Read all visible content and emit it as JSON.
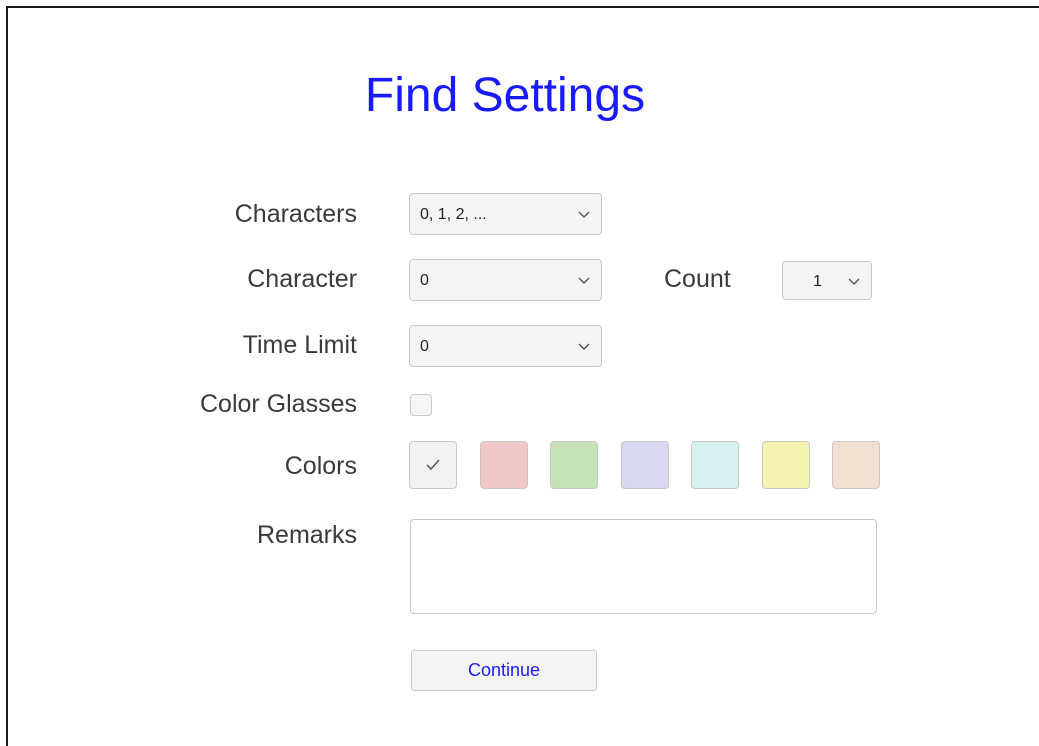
{
  "title": "Find Settings",
  "fields": {
    "characters": {
      "label": "Characters",
      "value": "0, 1, 2, ..."
    },
    "character": {
      "label": "Character",
      "value": "0"
    },
    "count": {
      "label": "Count",
      "value": "1"
    },
    "time_limit": {
      "label": "Time Limit",
      "value": "0"
    },
    "color_glasses": {
      "label": "Color Glasses",
      "checked": false
    },
    "colors": {
      "label": "Colors",
      "swatches": [
        "#f2f2f2",
        "#efc8c8",
        "#c8e2b8",
        "#d8d8f2",
        "#d8f2f2",
        "#f6f2b0",
        "#efe0d2"
      ],
      "selected_index": 0
    },
    "remarks": {
      "label": "Remarks",
      "value": ""
    }
  },
  "continue_label": "Continue",
  "colors_theme": {
    "title": "#1a1aff",
    "button_text": "#1a1aff"
  },
  "icons": {
    "chevron": "chevron-down-icon",
    "check": "check-icon"
  }
}
